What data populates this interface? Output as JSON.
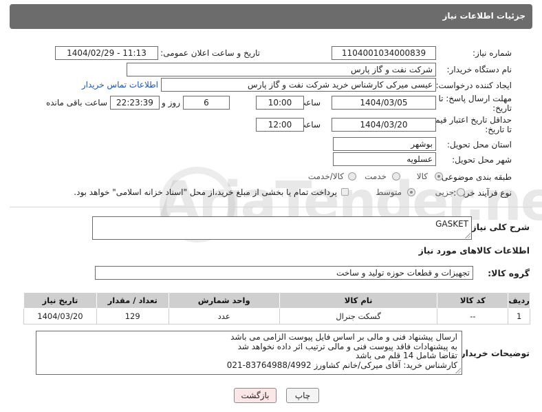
{
  "header": {
    "title": "جزئیات اطلاعات نیاز"
  },
  "fields": {
    "need_number_label": "شماره نیاز:",
    "need_number": "1104001034000839",
    "announce_label": "تاریخ و ساعت اعلان عمومی:",
    "announce_value": "1404/02/29 - 11:13",
    "buyer_org_label": "نام دستگاه خریدار:",
    "buyer_org": "شرکت نفت و گاز پارس",
    "creator_label": "ایجاد کننده درخواست:",
    "creator": "عیسی میرکی کارشناس خرید شرکت نفت و گاز پارس",
    "contact_link": "اطلاعات تماس خریدار",
    "reply_deadline_label_1": "مهلت ارسال پاسخ: تا",
    "reply_deadline_label_2": "تاریخ:",
    "reply_date": "1404/03/05",
    "time_label": "ساعت",
    "reply_time": "10:00",
    "days_value": "6",
    "days_label": "روز و",
    "remaining_time": "22:23:39",
    "remaining_label": "ساعت باقی مانده",
    "price_validity_label_1": "حداقل تاریخ اعتبار قیمت:",
    "price_validity_label_2": "تا تاریخ:",
    "price_date": "1404/03/20",
    "price_time": "12:00",
    "province_label": "استان محل تحویل:",
    "province": "بوشهر",
    "city_label": "شهر محل تحویل:",
    "city": "عسلویه",
    "category_label": "طبقه بندی موضوعی:",
    "category_options": [
      "کالا",
      "خدمت",
      "کالا/خدمت"
    ],
    "process_label": "نوع فرآیند خرید :",
    "process_options": [
      "جزیی",
      "متوسط"
    ],
    "payment_note": "پرداخت تمام یا بخشی از مبلغ خرید،از محل \"اسناد خزانه اسلامی\" خواهد بود.",
    "description_label": "شرح کلی نیاز:",
    "description": "GASKET"
  },
  "goods": {
    "section_title": "اطلاعات کالاهای مورد نیاز",
    "group_label": "گروه کالا:",
    "group_value": "تجهیزات و قطعات حوزه تولید و ساخت",
    "columns": [
      "ردیف",
      "کد کالا",
      "نام کالا",
      "واحد شمارش",
      "تعداد / مقدار",
      "تاریخ نیاز"
    ],
    "rows": [
      [
        "1",
        "--",
        "گسکت جنرال",
        "عدد",
        "129",
        "1404/03/20"
      ]
    ]
  },
  "notes": {
    "label": "توضیحات خریدار:",
    "lines": [
      "ارسال پیشنهاد فنی و مالی بر اساس فایل پیوست الزامی می باشد",
      "به پیشنهادات فاقد پیوست فنی و مالی ترتیب اثر داده نخواهد شد",
      "تقاضا شامل 14 قلم می باشد",
      "کارشناس خرید: آقای میرکی/خانم کشاورز  83764988/4992-021"
    ]
  },
  "buttons": {
    "print": "چاپ",
    "back": "بازگشت"
  },
  "watermark": "AriaTender.neT",
  "colors": {
    "header_bg": "#6c6c6c",
    "link": "#1a55b5",
    "table_header": "#cfcfcf",
    "back_button_bg": "#fde6e6"
  }
}
